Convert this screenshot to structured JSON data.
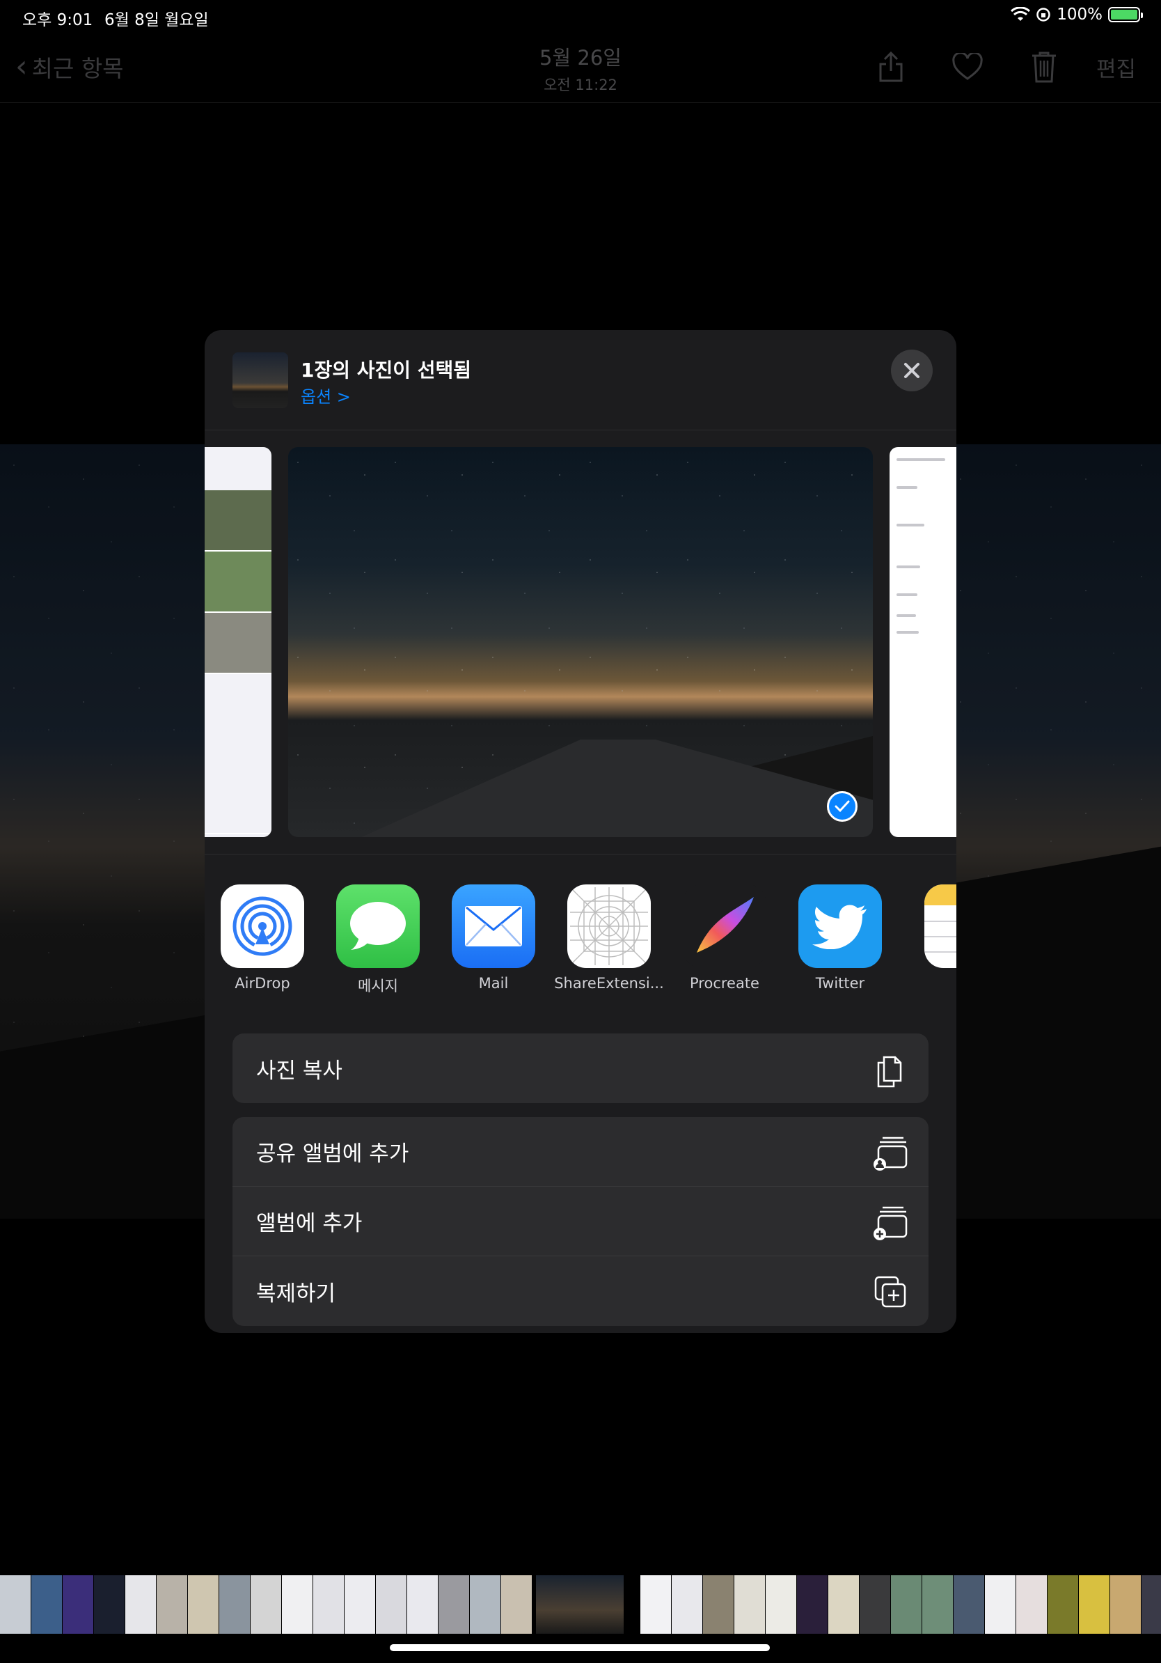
{
  "status_bar": {
    "time": "오후 9:01",
    "date": "6월 8일 월요일",
    "battery": "100%"
  },
  "nav": {
    "back_label": "최근 항목",
    "title_date": "5월 26일",
    "title_time": "오전 11:22",
    "edit_label": "편집"
  },
  "share_sheet": {
    "title": "1장의 사진이 선택됨",
    "options_label": "옵션 >",
    "apps": [
      {
        "label": "AirDrop",
        "icon": "airdrop-icon"
      },
      {
        "label": "메시지",
        "icon": "messages-icon"
      },
      {
        "label": "Mail",
        "icon": "mail-icon"
      },
      {
        "label": "ShareExtensi...",
        "icon": "share-extension-icon"
      },
      {
        "label": "Procreate",
        "icon": "procreate-icon"
      },
      {
        "label": "Twitter",
        "icon": "twitter-icon"
      }
    ],
    "actions": {
      "copy_photo": "사진 복사",
      "add_shared_album": "공유 앨범에 추가",
      "add_album": "앨범에 추가",
      "duplicate": "복제하기"
    }
  },
  "colors": {
    "accent": "#0a84ff",
    "sheet_bg": "#1c1c1e",
    "row_bg": "#2c2c2e"
  }
}
